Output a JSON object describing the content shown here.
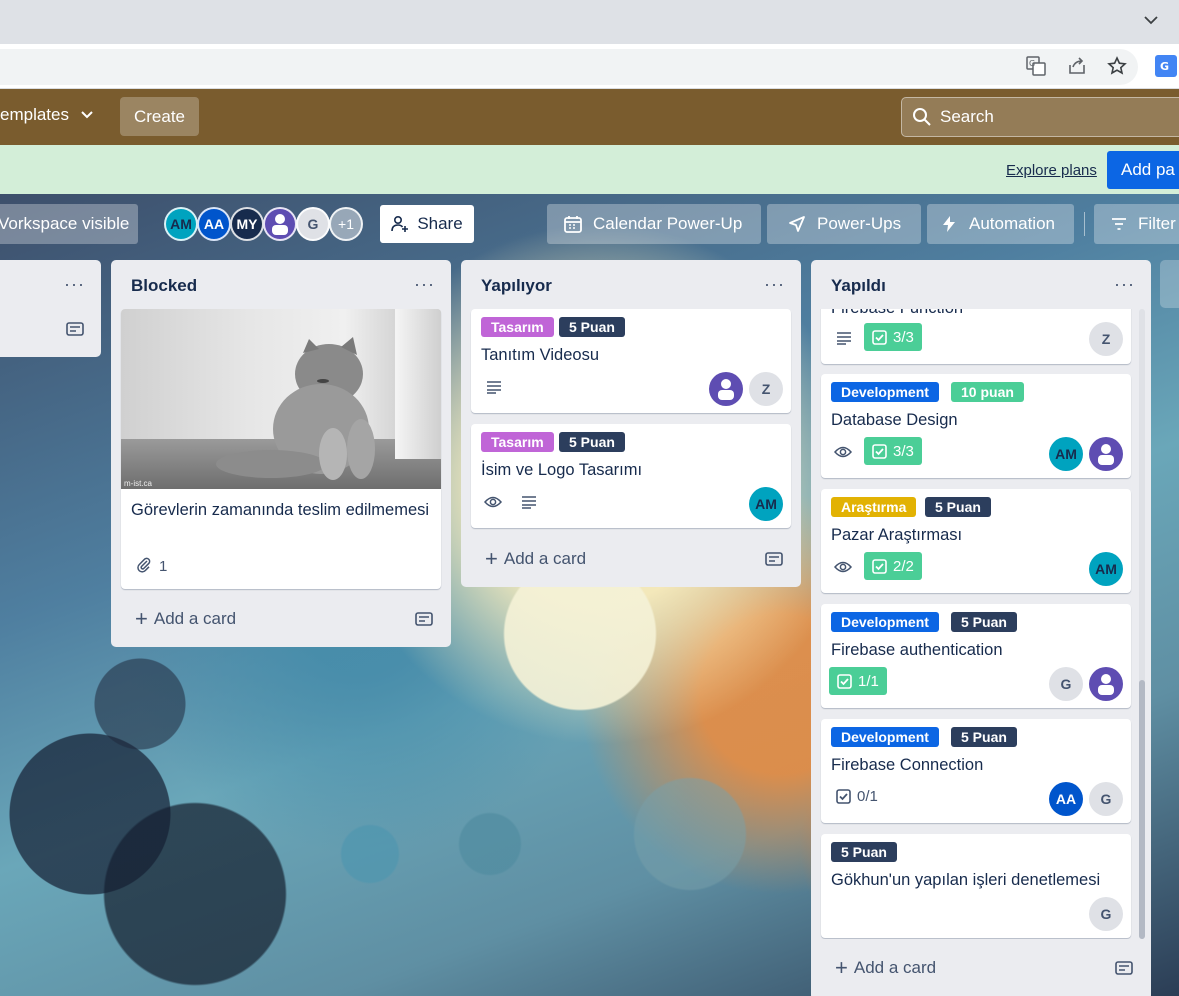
{
  "header": {
    "templates_label": "emplates",
    "create_label": "Create",
    "search_label": "Search"
  },
  "banner": {
    "explore_label": "Explore plans",
    "add_payment_label": "Add pa"
  },
  "board_bar": {
    "visibility_label": "Vorkspace visible",
    "members": [
      "AM",
      "AA",
      "MY",
      "",
      "G"
    ],
    "more_members": "+1",
    "share_label": "Share",
    "calendar_label": "Calendar Power-Up",
    "powerups_label": "Power-Ups",
    "automation_label": "Automation",
    "filter_label": "Filter"
  },
  "lists": [
    {
      "title": "",
      "menu": "···"
    },
    {
      "title": "Blocked",
      "menu": "···",
      "cards": [
        {
          "title": "Görevlerin zamanında teslim edilmemesi",
          "attachments": "1",
          "image_watermark": "m-ist.ca"
        }
      ],
      "add_card": "Add a card"
    },
    {
      "title": "Yapılıyor",
      "menu": "···",
      "cards": [
        {
          "labels": [
            "Tasarım",
            "5 Puan"
          ],
          "title": "Tanıtım Videosu",
          "members": [
            "",
            "Z"
          ]
        },
        {
          "labels": [
            "Tasarım",
            "5 Puan"
          ],
          "title": "İsim ve Logo Tasarımı",
          "members": [
            "AM"
          ]
        }
      ],
      "add_card": "Add a card"
    },
    {
      "title": "Yapıldı",
      "menu": "···",
      "cards": [
        {
          "title": "Firebase Function",
          "checklist": "3/3",
          "members": [
            "Z"
          ]
        },
        {
          "labels": [
            "Development",
            "10 puan"
          ],
          "title": "Database Design",
          "checklist": "3/3",
          "members": [
            "AM",
            ""
          ]
        },
        {
          "labels": [
            "Araştırma",
            "5 Puan"
          ],
          "title": "Pazar Araştırması",
          "checklist": "2/2",
          "members": [
            "AM"
          ]
        },
        {
          "labels": [
            "Development",
            "5 Puan"
          ],
          "title": "Firebase authentication",
          "checklist": "1/1",
          "members": [
            "G",
            ""
          ]
        },
        {
          "labels": [
            "Development",
            "5 Puan"
          ],
          "title": "Firebase Connection",
          "checklist": "0/1",
          "members": [
            "AA",
            "G"
          ]
        },
        {
          "labels": [
            "5 Puan"
          ],
          "title": "Gökhun'un yapılan işleri denetlemesi",
          "members": [
            "G"
          ]
        }
      ],
      "add_card": "Add a card"
    }
  ],
  "colors": {
    "header": "#7a5c2e",
    "banner": "#d3eed8",
    "label_tasarim": "#c065d7",
    "label_puan": "#2c3e5d",
    "label_development": "#0c66e4",
    "label_10puan": "#4bce97",
    "label_arastirma": "#e2b203",
    "checklist_complete": "#4bce97"
  },
  "icons": [
    "chevron-down-icon",
    "translate-icon",
    "share-icon",
    "star-icon",
    "search-icon",
    "calendar-icon",
    "rocket-icon",
    "bolt-icon",
    "filter-icon",
    "person-add-icon",
    "description-icon",
    "eye-icon",
    "checklist-icon",
    "paperclip-icon",
    "plus-icon",
    "card-template-icon"
  ]
}
